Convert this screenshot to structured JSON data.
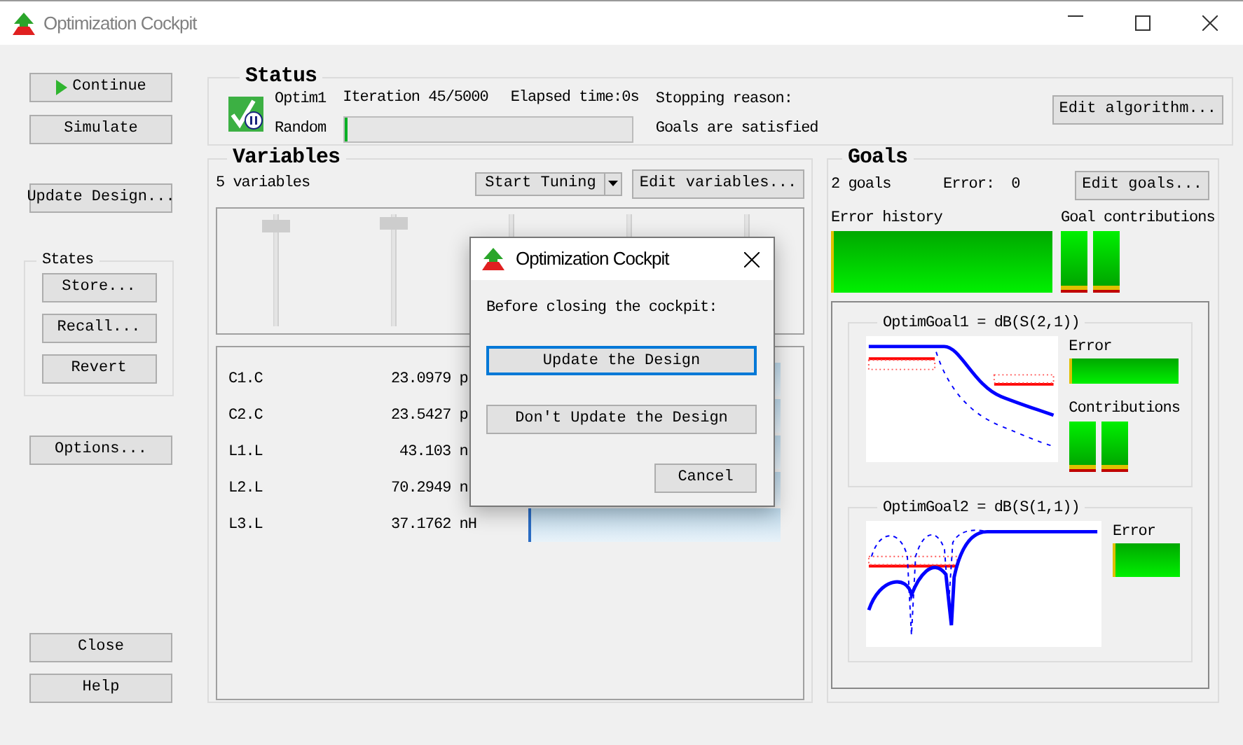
{
  "window": {
    "title": "Optimization Cockpit"
  },
  "side_buttons": [
    {
      "label": "Continue",
      "kind": "play"
    },
    {
      "label": "Simulate",
      "kind": "plain"
    },
    {
      "label": "Update Design...",
      "kind": "plain"
    }
  ],
  "states": {
    "title": "States",
    "buttons": [
      "Store...",
      "Recall...",
      "Revert"
    ]
  },
  "options_button": "Options...",
  "bottom_buttons": [
    "Close",
    "Help"
  ],
  "status": {
    "title": "Status",
    "optimizer": "Optim1",
    "method": "Random",
    "iteration": "Iteration 45/5000",
    "elapsed": "Elapsed time:0s",
    "progress": {
      "level": 0.01
    },
    "stopping_label": "Stopping reason:",
    "stopping_reason": "Goals are satisfied",
    "button": "Edit algorithm..."
  },
  "variables": {
    "title": "Variables",
    "count": "5 variables",
    "tuning_button": "Start Tuning",
    "edit_button": "Edit variables...",
    "sliders": [
      {
        "kind": "thumb",
        "level": 0.95
      },
      {
        "kind": "thumb",
        "level": 0.97
      },
      {
        "kind": "covered"
      },
      {
        "kind": "covered"
      },
      {
        "kind": "covered"
      }
    ],
    "rows": [
      {
        "name": "C1.C",
        "value": "23.0979 p"
      },
      {
        "name": "C2.C",
        "value": "23.5427 p"
      },
      {
        "name": "L1.L",
        "value": "43.103 n"
      },
      {
        "name": "L2.L",
        "value": "70.2949 n"
      },
      {
        "name": "L3.L",
        "value": "37.1762 nH"
      }
    ]
  },
  "goals": {
    "title": "Goals",
    "count": "2 goals",
    "error_label": "Error:",
    "error_value": "0",
    "edit_button": "Edit goals...",
    "history_label": "Error history",
    "contributions_label": "Goal contributions",
    "items": [
      {
        "kind": "lowpass",
        "title": "OptimGoal1 = dB(S(2,1))",
        "error_label": "Error",
        "contributions_label": "Contributions"
      },
      {
        "kind": "match",
        "title": "OptimGoal2 = dB(S(1,1))",
        "error_label": "Error"
      }
    ]
  },
  "dialog": {
    "title": "Optimization Cockpit",
    "message": "Before closing the cockpit:",
    "buttons": [
      {
        "label": "Update the Design",
        "focused": true
      },
      {
        "label": "Don't Update the Design",
        "focused": false
      }
    ],
    "cancel": "Cancel"
  }
}
